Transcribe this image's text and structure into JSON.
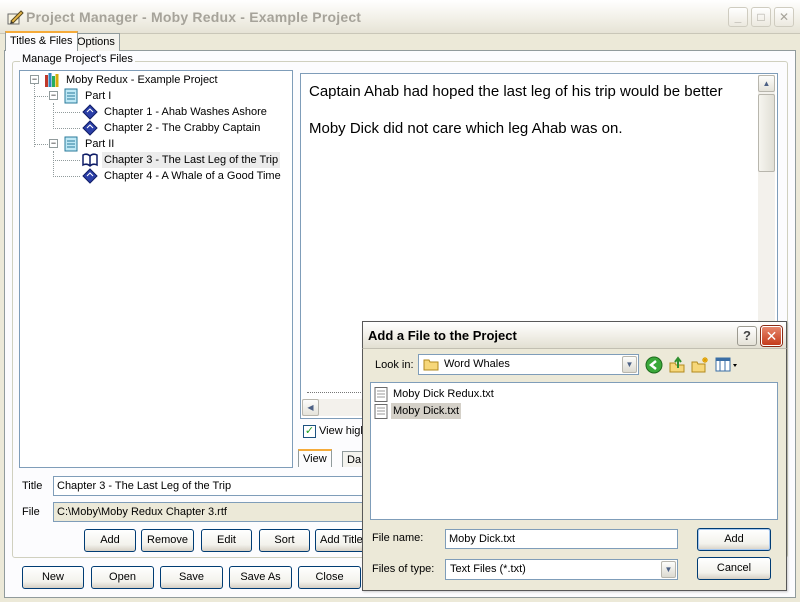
{
  "window": {
    "title": "Project Manager - Moby Redux - Example Project"
  },
  "tabs": [
    {
      "label": "Titles & Files"
    },
    {
      "label": "Options"
    }
  ],
  "group": {
    "label": "Manage Project's Files"
  },
  "tree": {
    "root": "Moby Redux - Example Project",
    "parts": [
      {
        "label": "Part I",
        "chapters": [
          "Chapter 1 - Ahab Washes Ashore",
          "Chapter 2 - The Crabby Captain"
        ]
      },
      {
        "label": "Part II",
        "chapters": [
          "Chapter 3 - The Last Leg of the Trip",
          "Chapter 4 - A Whale of a Good Time"
        ]
      }
    ],
    "selected": "Chapter 3 - The Last Leg of the Trip"
  },
  "preview": {
    "lines": [
      "Captain Ahab had hoped the last leg of his trip would be better",
      "Moby Dick did not care which leg Ahab was on."
    ],
    "checkbox_label": "View high",
    "tabs": [
      {
        "label": "View"
      },
      {
        "label": "Da"
      }
    ]
  },
  "form": {
    "title_label": "Title",
    "title_value": "Chapter 3 - The Last Leg of the Trip",
    "file_label": "File",
    "file_value": "C:\\Moby\\Moby Redux Chapter 3.rtf"
  },
  "list_buttons": [
    "Add",
    "Remove",
    "Edit",
    "Sort",
    "Add Title"
  ],
  "bottom_buttons": [
    "New",
    "Open",
    "Save",
    "Save As",
    "Close"
  ],
  "dialog": {
    "title": "Add a File to the Project",
    "help_label": "?",
    "close_label": "✕",
    "look_in_label": "Look in:",
    "look_in_value": "Word Whales",
    "files": [
      "Moby Dick Redux.txt",
      "Moby Dick.txt"
    ],
    "selected_file": "Moby Dick.txt",
    "file_name_label": "File name:",
    "file_name_value": "Moby Dick.txt",
    "file_type_label": "Files of type:",
    "file_type_value": "Text Files (*.txt)",
    "add_button": "Add",
    "cancel_button": "Cancel"
  },
  "icons": {
    "app": "pencil-icon",
    "book": "books-icon",
    "part": "document-icon",
    "chapter": "diamond-icon",
    "chapter_open": "open-book-icon",
    "folder": "folder-icon",
    "back": "back-arrow-icon",
    "up": "up-folder-icon",
    "new_folder": "new-folder-icon",
    "views": "view-menu-icon",
    "file": "text-file-icon"
  },
  "colors": {
    "accent": "#f5ab3a",
    "selection": "#d4d0c8",
    "close_red": "#c43b1b",
    "back_green": "#3aa83a",
    "text_blue": "#0000aa"
  }
}
